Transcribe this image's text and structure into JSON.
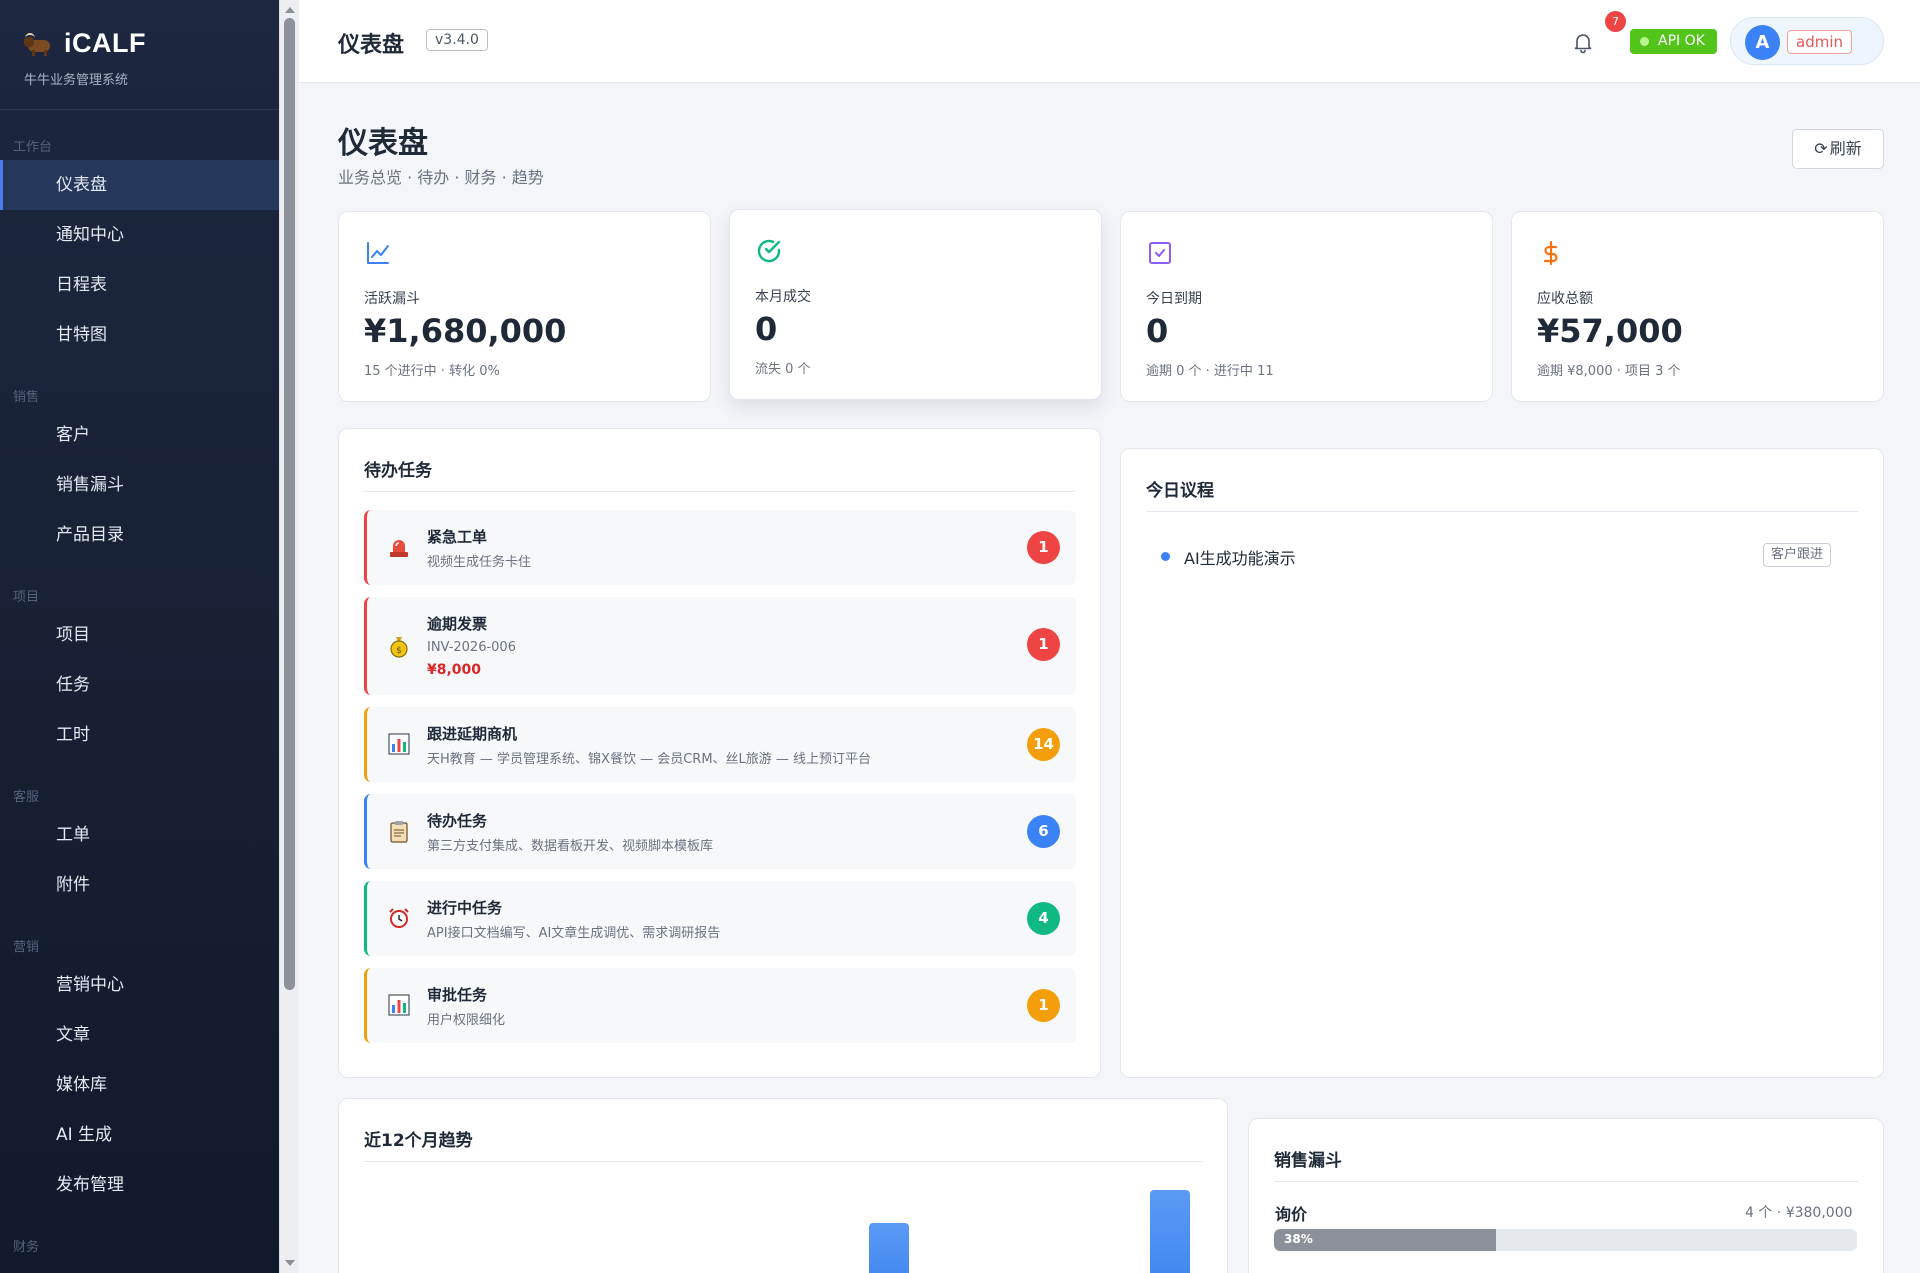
{
  "brand": {
    "name": "iCALF",
    "subtitle": "牛牛业务管理系统"
  },
  "sidebar": {
    "groups": [
      {
        "title": "工作台",
        "items": [
          {
            "label": "仪表盘"
          },
          {
            "label": "通知中心"
          },
          {
            "label": "日程表"
          },
          {
            "label": "甘特图"
          }
        ]
      },
      {
        "title": "销售",
        "items": [
          {
            "label": "客户"
          },
          {
            "label": "销售漏斗"
          },
          {
            "label": "产品目录"
          }
        ]
      },
      {
        "title": "项目",
        "items": [
          {
            "label": "项目"
          },
          {
            "label": "任务"
          },
          {
            "label": "工时"
          }
        ]
      },
      {
        "title": "客服",
        "items": [
          {
            "label": "工单"
          },
          {
            "label": "附件"
          }
        ]
      },
      {
        "title": "营销",
        "items": [
          {
            "label": "营销中心"
          },
          {
            "label": "文章"
          },
          {
            "label": "媒体库"
          },
          {
            "label": "AI 生成"
          },
          {
            "label": "发布管理"
          }
        ]
      },
      {
        "title": "财务",
        "items": []
      }
    ]
  },
  "header": {
    "title": "仪表盘",
    "version": "v3.4.0",
    "notification_count": "7",
    "api_status": "API OK",
    "avatar_initial": "A",
    "username": "admin"
  },
  "page": {
    "title": "仪表盘",
    "subtitle": "业务总览 · 待办 · 财务 · 趋势",
    "refresh_label": "刷新"
  },
  "stats": [
    {
      "icon": "line-chart-icon",
      "label": "活跃漏斗",
      "value": "¥1,680,000",
      "foot": "15 个进行中 · 转化 0%",
      "color": "#3b82f6"
    },
    {
      "icon": "check-circle-icon",
      "label": "本月成交",
      "value": "0",
      "foot": "流失 0 个",
      "color": "#10b981"
    },
    {
      "icon": "calendar-check-icon",
      "label": "今日到期",
      "value": "0",
      "foot": "逾期 0 个 · 进行中 11",
      "color": "#8b5cf6"
    },
    {
      "icon": "dollar-icon",
      "label": "应收总额",
      "value": "¥57,000",
      "foot": "逾期 ¥8,000 · 项目 3 个",
      "color": "#f97316"
    }
  ],
  "todo": {
    "title": "待办任务",
    "items": [
      {
        "icon": "siren-icon",
        "title": "紧急工单",
        "desc": "视频生成任务卡住",
        "count": "1",
        "accent": "#ef4444"
      },
      {
        "icon": "money-bag-icon",
        "title": "逾期发票",
        "desc": "INV-2026-006",
        "amount": "¥8,000",
        "count": "1",
        "accent": "#ef4444"
      },
      {
        "icon": "bar-chart-icon",
        "title": "跟进延期商机",
        "desc": "天H教育 — 学员管理系统、锦X餐饮 — 会员CRM、丝L旅游 — 线上预订平台",
        "count": "14",
        "accent": "#f59e0b"
      },
      {
        "icon": "clipboard-icon",
        "title": "待办任务",
        "desc": "第三方支付集成、数据看板开发、视频脚本模板库",
        "count": "6",
        "accent": "#3b82f6"
      },
      {
        "icon": "alarm-clock-icon",
        "title": "进行中任务",
        "desc": "API接口文档编写、AI文章生成调优、需求调研报告",
        "count": "4",
        "accent": "#10b981"
      },
      {
        "icon": "bar-chart-icon",
        "title": "审批任务",
        "desc": "用户权限细化",
        "count": "1",
        "accent": "#f59e0b"
      }
    ]
  },
  "agenda": {
    "title": "今日议程",
    "items": [
      {
        "label": "AI生成功能演示",
        "tag": "客户跟进"
      }
    ]
  },
  "trend": {
    "title": "近12个月趋势"
  },
  "funnel": {
    "title": "销售漏斗",
    "stages": [
      {
        "name": "询价",
        "meta": "4 个 · ¥380,000",
        "percent": 38,
        "percent_label": "38%"
      }
    ]
  }
}
